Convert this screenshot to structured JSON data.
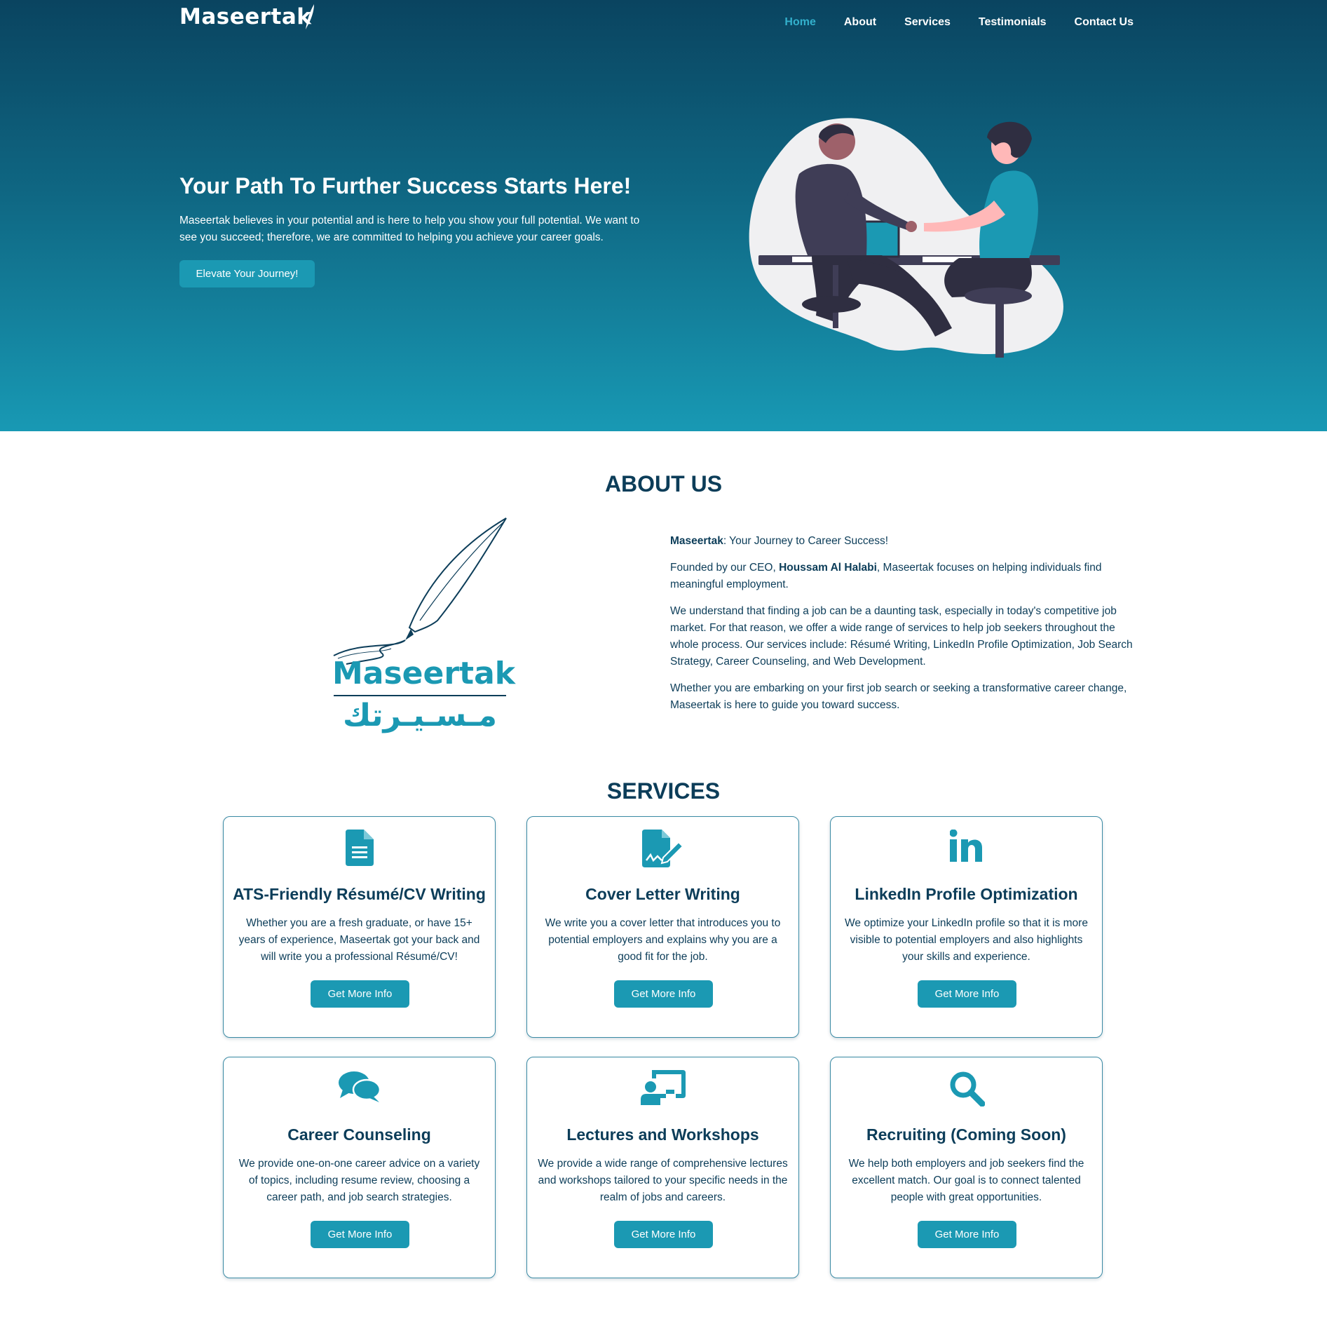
{
  "brand": {
    "name": "Maseertak",
    "arabic_name": "مـسـيـرتك",
    "accent": "#1b99b3",
    "dark": "#0c3d59"
  },
  "nav": {
    "items": [
      {
        "label": "Home",
        "active": true
      },
      {
        "label": "About",
        "active": false
      },
      {
        "label": "Services",
        "active": false
      },
      {
        "label": "Testimonials",
        "active": false
      },
      {
        "label": "Contact Us",
        "active": false
      }
    ]
  },
  "hero": {
    "title": "Your Path To Further Success Starts Here!",
    "description": "Maseertak believes in your potential and is here to help you show your full potential. We want to see you succeed; therefore, we are committed to helping you achieve your career goals.",
    "button": "Elevate Your Journey!"
  },
  "about": {
    "title": "ABOUT US",
    "p1_brand": "Maseertak",
    "p1_rest": ": Your Journey to Career Success!",
    "p2_pre": "Founded by our CEO, ",
    "p2_ceo": "Houssam Al Halabi",
    "p2_post": ", Maseertak focuses on helping individuals find meaningful employment.",
    "p3": "We understand that finding a job can be a daunting task, especially in today's competitive job market. For that reason, we offer a wide range of services to help job seekers throughout the whole process. Our services include: Résumé Writing, LinkedIn Profile Optimization, Job Search Strategy, Career Counseling, and Web Development.",
    "p4": "Whether you are embarking on your first job search or seeking a transformative career change, Maseertak is here to guide you toward success."
  },
  "services": {
    "title": "SERVICES",
    "cards": [
      {
        "icon": "document-icon",
        "title": "ATS-Friendly Résumé/CV Writing",
        "description": "Whether you are a fresh graduate, or have 15+ years of experience, Maseertak got your back and will write you a professional Résumé/CV!",
        "button": "Get More Info"
      },
      {
        "icon": "file-signature-icon",
        "title": "Cover Letter Writing",
        "description": "We write you a cover letter that introduces you to potential employers and explains why you are a good fit for the job.",
        "button": "Get More Info"
      },
      {
        "icon": "linkedin-icon",
        "title": "LinkedIn Profile Optimization",
        "description": "We optimize your LinkedIn profile so that it is more visible to potential employers and also highlights your skills and experience.",
        "button": "Get More Info"
      },
      {
        "icon": "chat-bubbles-icon",
        "title": "Career Counseling",
        "description": "We provide one-on-one career advice on a variety of topics, including resume review, choosing a career path, and job search strategies.",
        "button": "Get More Info"
      },
      {
        "icon": "teacher-board-icon",
        "title": "Lectures and Workshops",
        "description": "We provide a wide range of comprehensive lectures and workshops tailored to your specific needs in the realm of jobs and careers.",
        "button": "Get More Info"
      },
      {
        "icon": "search-icon",
        "title": "Recruiting (Coming Soon)",
        "description": "We help both employers and job seekers find the excellent match. Our goal is to connect talented people with great opportunities.",
        "button": "Get More Info"
      }
    ]
  }
}
